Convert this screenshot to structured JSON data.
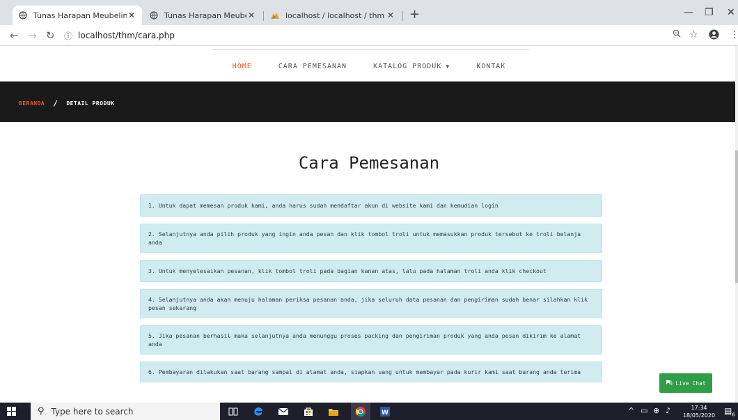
{
  "browser": {
    "tabs": [
      {
        "title": "Tunas Harapan Meubelindo",
        "icon": "globe-icon",
        "active": true
      },
      {
        "title": "Tunas Harapan Meubelindo",
        "icon": "globe-icon",
        "active": false
      },
      {
        "title": "localhost / localhost / thm / surv",
        "icon": "phpmyadmin-icon",
        "active": false
      }
    ],
    "url": "localhost/thm/cara.php"
  },
  "nav": {
    "items": [
      {
        "label": "HOME",
        "active": true
      },
      {
        "label": "CARA PEMESANAN",
        "active": false
      },
      {
        "label": "KATALOG PRODUK",
        "active": false,
        "dropdown": true
      },
      {
        "label": "KONTAK",
        "active": false
      }
    ]
  },
  "breadcrumb": {
    "home": "BERANDA",
    "separator": "/",
    "current": "DETAIL PRODUK"
  },
  "page": {
    "title": "Cara Pemesanan",
    "steps": [
      "1. Untuk dapat memesan produk kami, anda harus sudah mendaftar akun di website kami dan kemudian login",
      "2. Selanjutnya anda pilih produk yang ingin anda pesan dan klik tombol troli untuk memasukkan produk tersebut ke troli belanja anda",
      "3. Untuk menyelesaikan pesanan, klik tombol troli pada bagian kanan atas, lalu pada halaman troli anda klik checkout",
      "4. Selanjutnya anda akan menuju halaman periksa pesanan anda, jika seluruh data pesanan dan pengiriman sudah benar silahkan klik pesan sekarang",
      "5. Jika pesanan berhasil maka selanjutnya anda menunggu proses packing dan pengiriman produk yang anda pesan dikirim ke alamat anda",
      "6. Pembayaran dilakukan saat barang sampai di alamat anda, siapkan uang untuk membayar pada kurir kami saat barang anda terima"
    ]
  },
  "livechat": {
    "label": "Live Chat"
  },
  "taskbar": {
    "search_placeholder": "Type here to search",
    "time": "17:34",
    "date": "18/05/2020",
    "notifications": "6"
  },
  "colors": {
    "accent": "#e8581c",
    "banner": "#1a1a1a",
    "step_bg": "#d1ecf1",
    "livechat": "#2e9e48"
  }
}
